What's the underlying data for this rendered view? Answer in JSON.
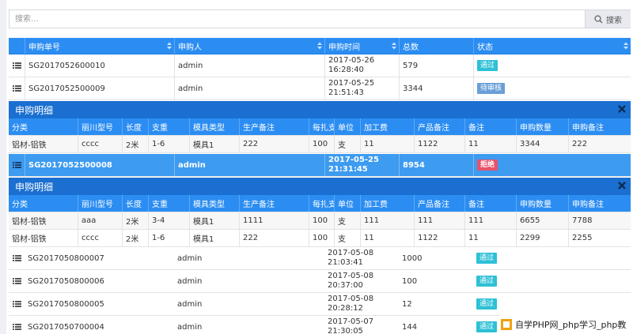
{
  "search": {
    "placeholder": "搜索...",
    "button_label": "搜索"
  },
  "orders_table": {
    "columns": [
      "申购单号",
      "申购人",
      "申购时间",
      "总数",
      "状态"
    ],
    "rows": [
      {
        "id": "SG2017052600010",
        "user": "admin",
        "date": "2017-05-26",
        "time": "16:28:40",
        "total": "579",
        "status": "通过",
        "status_color": "#2ec0d6"
      },
      {
        "id": "SG2017052500009",
        "user": "admin",
        "date": "2017-05-25",
        "time": "21:51:43",
        "total": "3344",
        "status": "待审核",
        "status_color": "#6a9fd8"
      },
      {
        "id": "SG2017052500008",
        "user": "admin",
        "date": "2017-05-25",
        "time": "21:31:45",
        "total": "8954",
        "status": "拒绝",
        "status_color": "#e8526a"
      },
      {
        "id": "SG2017050800007",
        "user": "admin",
        "date": "2017-05-08",
        "time": "21:03:41",
        "total": "1000",
        "status": "通过",
        "status_color": "#2ec0d6"
      },
      {
        "id": "SG2017050800006",
        "user": "admin",
        "date": "2017-05-08",
        "time": "20:37:00",
        "total": "100",
        "status": "通过",
        "status_color": "#2ec0d6"
      },
      {
        "id": "SG2017050800005",
        "user": "admin",
        "date": "2017-05-08",
        "time": "20:28:12",
        "total": "12",
        "status": "通过",
        "status_color": "#2ec0d6"
      },
      {
        "id": "SG2017050700004",
        "user": "admin",
        "date": "2017-05-07",
        "time": "21:30:05",
        "total": "144",
        "status": "通过",
        "status_color": "#2ec0d6"
      }
    ]
  },
  "detail": {
    "title": "申购明细",
    "columns": [
      "分类",
      "丽川型号",
      "长度",
      "支重",
      "模具类型",
      "生产备注",
      "每扎支数",
      "单位",
      "加工费",
      "产品备注",
      "备注",
      "申购数量",
      "申购备注"
    ],
    "panel1_rows": [
      [
        "铝材-铝铁",
        "cccc",
        "2米",
        "1-6",
        "模具1",
        "222",
        "100",
        "支",
        "11",
        "1122",
        "11",
        "3344",
        "222"
      ]
    ],
    "panel2_rows": [
      [
        "铝材-铝铁",
        "aaa",
        "2米",
        "3-4",
        "模具1",
        "1111",
        "100",
        "支",
        "111",
        "111",
        "111",
        "6655",
        "7788"
      ],
      [
        "铝材-铝铁",
        "cccc",
        "2米",
        "1-6",
        "模具1",
        "222",
        "100",
        "支",
        "11",
        "1122",
        "11",
        "2299",
        "2255"
      ]
    ]
  },
  "watermark": {
    "text": "自学PHP网_php学习_php教"
  },
  "colors": {
    "header_blue": "#2b8df2",
    "detail_title_blue": "#1a6fd0",
    "selected_blue": "#3d9bf0"
  }
}
